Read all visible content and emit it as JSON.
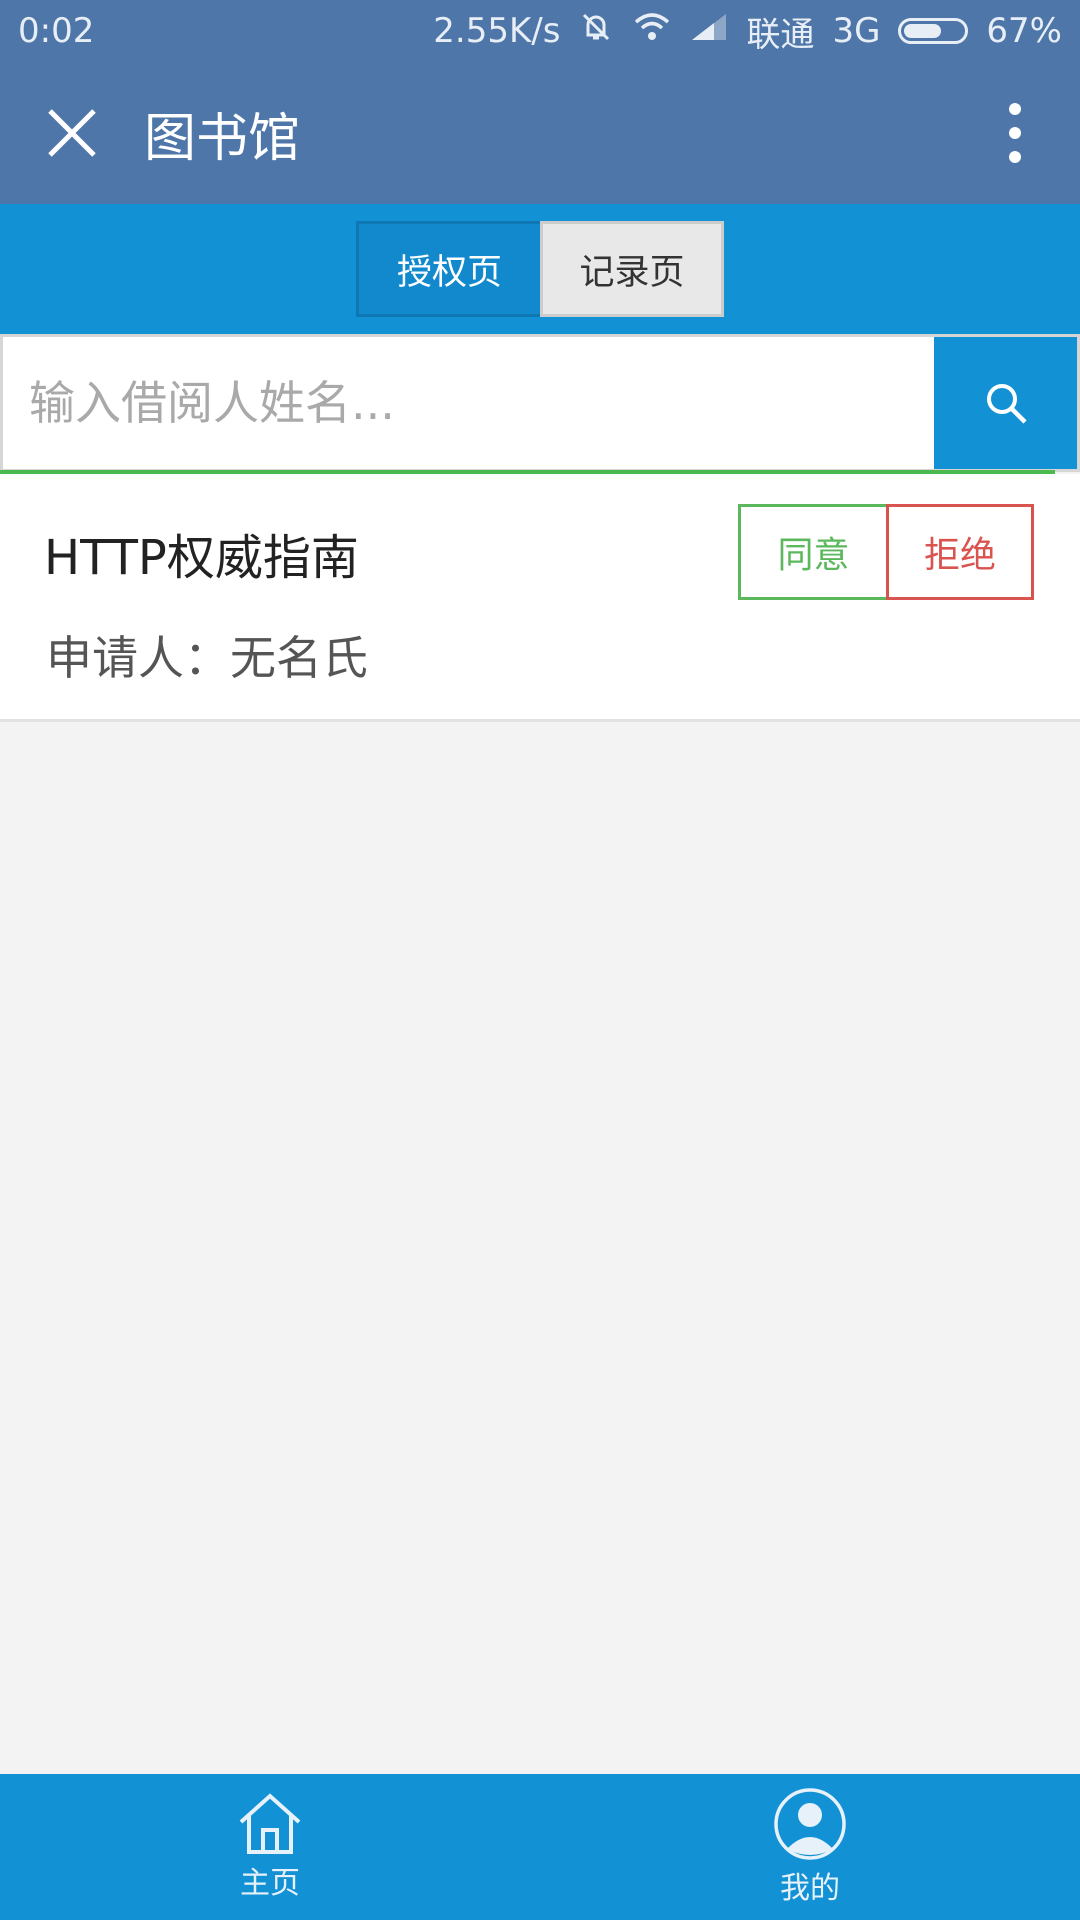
{
  "status_bar": {
    "time": "0:02",
    "speed": "2.55K/s",
    "carrier": "联通",
    "network": "3G",
    "battery": "67%",
    "battery_level": 0.67,
    "icons": [
      "silent-bell-icon",
      "wifi-icon",
      "signal-icon",
      "battery-icon"
    ]
  },
  "header": {
    "title": "图书馆",
    "close_icon": "close-icon",
    "more_icon": "more-vert-icon"
  },
  "tabs": [
    {
      "label": "授权页",
      "active": true
    },
    {
      "label": "记录页",
      "active": false
    }
  ],
  "search": {
    "placeholder": "输入借阅人姓名...",
    "value": "",
    "button_icon": "search-icon"
  },
  "requests": [
    {
      "title": "HTTP权威指南",
      "applicant": "申请人：无名氏",
      "agree_label": "同意",
      "reject_label": "拒绝"
    }
  ],
  "bottom_nav": [
    {
      "label": "主页",
      "icon": "home-icon"
    },
    {
      "label": "我的",
      "icon": "user-avatar-icon"
    }
  ],
  "colors": {
    "header_bg": "#4e76a9",
    "accent": "#1391d5",
    "agree": "#5cb85c",
    "reject": "#d9534f",
    "progress": "#4cb94e"
  }
}
